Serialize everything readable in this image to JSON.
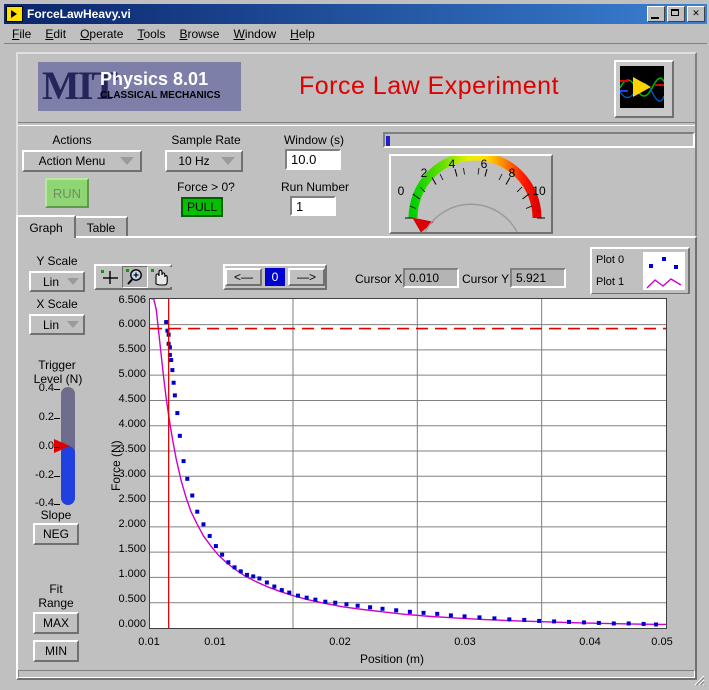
{
  "window": {
    "title": "ForceLawHeavy.vi",
    "icon": "labview-vi-icon",
    "buttons": {
      "minimize": "_",
      "maximize": "□",
      "close": "✕"
    }
  },
  "menu": {
    "items": [
      "File",
      "Edit",
      "Operate",
      "Tools",
      "Browse",
      "Window",
      "Help"
    ]
  },
  "header": {
    "logo": {
      "mit": "MIT",
      "course": "Physics 8.01",
      "subtitle": "CLASSICAL MECHANICS"
    },
    "title": "Force Law Experiment",
    "labview_icon": "labview-logo-icon"
  },
  "controls": {
    "actions_label": "Actions",
    "action_menu_value": "Action Menu",
    "run_label": "RUN",
    "sample_rate_label": "Sample Rate",
    "sample_rate_value": "10 Hz",
    "force_gt_zero_label": "Force > 0?",
    "pull_label": "PULL",
    "window_label": "Window (s)",
    "window_value": "10.0",
    "run_number_label": "Run Number",
    "run_number_value": "1"
  },
  "gauge": {
    "ticks": [
      "0",
      "2",
      "4",
      "6",
      "8",
      "10"
    ],
    "value": 0,
    "min": 0,
    "max": 10,
    "needle_color": "#e00000"
  },
  "tabs": [
    {
      "label": "Graph",
      "active": true
    },
    {
      "label": "Table",
      "active": false
    }
  ],
  "graph_controls": {
    "y_scale_label": "Y Scale",
    "y_scale_value": "Lin",
    "x_scale_label": "X Scale",
    "x_scale_value": "Lin",
    "palette_tools": [
      "cursor-move-icon",
      "zoom-icon",
      "pan-hand-icon"
    ],
    "palette_selected_index": 1,
    "nav_prev": "<—",
    "nav_index": "0",
    "nav_next": "—>",
    "cursor_x_label": "Cursor X",
    "cursor_x_value": "0.010",
    "cursor_y_label": "Cursor Y",
    "cursor_y_value": "5.921",
    "legend": [
      {
        "name": "Plot 0",
        "style": "scatter",
        "color": "#0000cc"
      },
      {
        "name": "Plot 1",
        "style": "line",
        "color": "#cc00cc"
      }
    ]
  },
  "trigger": {
    "label_line1": "Trigger",
    "label_line2": "Level (N)",
    "ticks": [
      "0.4",
      "0.2",
      "0.0",
      "-0.2",
      "-0.4"
    ],
    "value": 0.0,
    "min": -0.4,
    "max": 0.4,
    "slope_label": "Slope",
    "slope_value": "NEG",
    "fit_range_line1": "Fit",
    "fit_range_line2": "Range",
    "fit_max": "MAX",
    "fit_min": "MIN"
  },
  "chart_data": {
    "type": "scatter",
    "title": "",
    "xlabel": "Position (m)",
    "ylabel": "Force (N)",
    "xlim": [
      0.0085,
      0.05
    ],
    "ylim": [
      0.0,
      6.506
    ],
    "grid": true,
    "xticks": [
      0.01,
      0.02,
      0.03,
      0.04,
      0.05
    ],
    "xticklabels": [
      "0.01",
      "0.01",
      "0.02",
      "0.03",
      "0.04",
      "0.05"
    ],
    "yticks": [
      0.0,
      0.5,
      1.0,
      1.5,
      2.0,
      2.5,
      3.0,
      3.5,
      4.0,
      4.5,
      5.0,
      5.5,
      6.0,
      6.506
    ],
    "yticklabels": [
      "0.000",
      "0.500",
      "1.000",
      "1.500",
      "2.000",
      "2.500",
      "3.000",
      "3.500",
      "4.000",
      "4.500",
      "5.000",
      "5.500",
      "6.000",
      "6.506"
    ],
    "cursor_x": 0.01,
    "cursor_y": 5.921,
    "cursor_color": "#e00000",
    "series": [
      {
        "name": "Plot 0",
        "style": "scatter",
        "color": "#0000cc",
        "x": [
          0.0098,
          0.0099,
          0.01,
          0.01,
          0.0101,
          0.0101,
          0.0102,
          0.0103,
          0.0104,
          0.0105,
          0.0107,
          0.0109,
          0.0112,
          0.0115,
          0.0119,
          0.0123,
          0.0128,
          0.0133,
          0.0138,
          0.0143,
          0.0148,
          0.0153,
          0.0158,
          0.0163,
          0.0168,
          0.0173,
          0.0179,
          0.0185,
          0.0191,
          0.0197,
          0.0204,
          0.0211,
          0.0218,
          0.0226,
          0.0234,
          0.0243,
          0.0252,
          0.0262,
          0.0272,
          0.0283,
          0.0294,
          0.0305,
          0.0316,
          0.0327,
          0.0338,
          0.035,
          0.0362,
          0.0374,
          0.0386,
          0.0398,
          0.041,
          0.0422,
          0.0434,
          0.0446,
          0.0458,
          0.047,
          0.0482,
          0.0492
        ],
        "y": [
          6.05,
          5.88,
          5.8,
          5.62,
          5.55,
          5.4,
          5.3,
          5.1,
          4.85,
          4.6,
          4.25,
          3.8,
          3.3,
          2.95,
          2.62,
          2.3,
          2.05,
          1.82,
          1.62,
          1.45,
          1.3,
          1.2,
          1.12,
          1.05,
          1.02,
          0.98,
          0.9,
          0.82,
          0.75,
          0.7,
          0.64,
          0.6,
          0.56,
          0.52,
          0.5,
          0.47,
          0.44,
          0.41,
          0.38,
          0.35,
          0.32,
          0.3,
          0.28,
          0.25,
          0.23,
          0.21,
          0.19,
          0.17,
          0.16,
          0.14,
          0.13,
          0.12,
          0.11,
          0.1,
          0.09,
          0.09,
          0.08,
          0.07
        ]
      },
      {
        "name": "Plot 1",
        "style": "line",
        "color": "#cc00cc",
        "description": "inverse-square fit curve",
        "x": [
          0.0086,
          0.0088,
          0.009,
          0.0092,
          0.0094,
          0.0096,
          0.0098,
          0.01,
          0.0103,
          0.0106,
          0.011,
          0.0114,
          0.0118,
          0.0123,
          0.0128,
          0.0134,
          0.014,
          0.0147,
          0.0154,
          0.0162,
          0.017,
          0.018,
          0.019,
          0.02,
          0.0212,
          0.0225,
          0.024,
          0.0255,
          0.0272,
          0.029,
          0.031,
          0.033,
          0.0352,
          0.0375,
          0.04,
          0.0425,
          0.045,
          0.0475,
          0.05
        ],
        "y": [
          6.51,
          6.51,
          6.3,
          5.85,
          5.4,
          4.95,
          4.55,
          4.2,
          3.75,
          3.35,
          2.92,
          2.58,
          2.3,
          2.05,
          1.82,
          1.62,
          1.44,
          1.28,
          1.15,
          1.02,
          0.92,
          0.81,
          0.72,
          0.64,
          0.56,
          0.49,
          0.42,
          0.37,
          0.32,
          0.27,
          0.23,
          0.2,
          0.17,
          0.145,
          0.125,
          0.105,
          0.09,
          0.078,
          0.07
        ]
      }
    ]
  }
}
